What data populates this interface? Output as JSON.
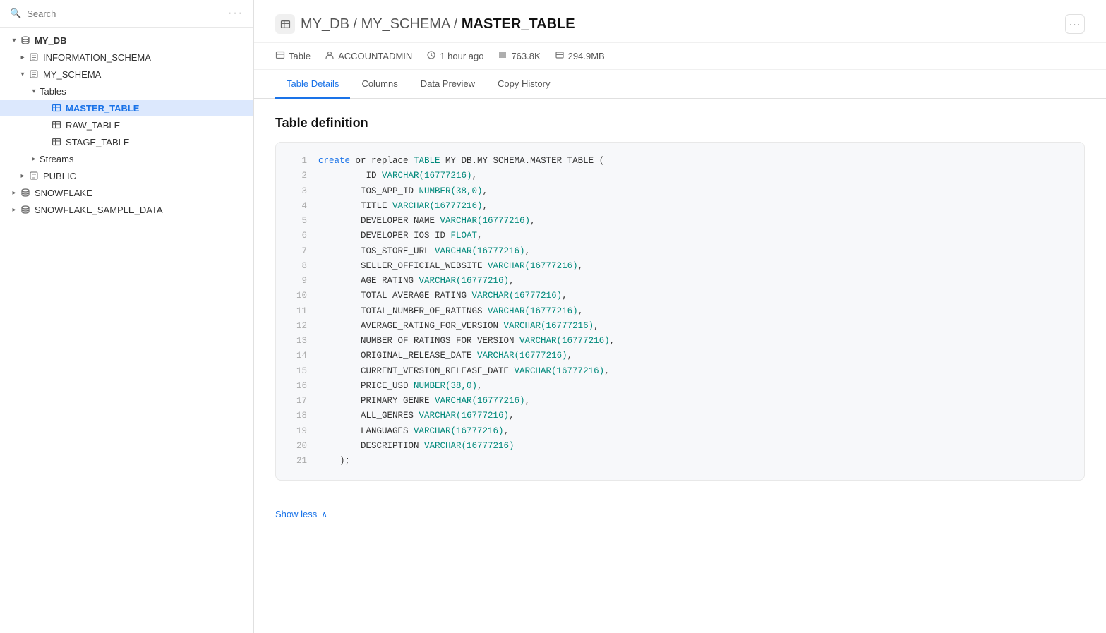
{
  "sidebar": {
    "search_placeholder": "Search",
    "databases": [
      {
        "name": "MY_DB",
        "expanded": true,
        "children": [
          {
            "name": "INFORMATION_SCHEMA",
            "type": "schema",
            "expanded": false
          },
          {
            "name": "MY_SCHEMA",
            "type": "schema",
            "expanded": true,
            "children": [
              {
                "name": "Tables",
                "type": "group",
                "expanded": true,
                "children": [
                  {
                    "name": "MASTER_TABLE",
                    "type": "table",
                    "selected": true
                  },
                  {
                    "name": "RAW_TABLE",
                    "type": "table",
                    "selected": false
                  },
                  {
                    "name": "STAGE_TABLE",
                    "type": "table",
                    "selected": false
                  }
                ]
              },
              {
                "name": "Streams",
                "type": "group",
                "expanded": false
              }
            ]
          },
          {
            "name": "PUBLIC",
            "type": "schema",
            "expanded": false
          }
        ]
      },
      {
        "name": "SNOWFLAKE",
        "expanded": false
      },
      {
        "name": "SNOWFLAKE_SAMPLE_DATA",
        "expanded": false
      }
    ]
  },
  "main": {
    "breadcrumb": {
      "db": "MY_DB",
      "schema": "MY_SCHEMA",
      "table": "MASTER_TABLE",
      "separator": " / "
    },
    "meta": {
      "type": "Table",
      "owner": "ACCOUNTADMIN",
      "modified": "1 hour ago",
      "rows": "763.8K",
      "size": "294.9MB"
    },
    "tabs": [
      {
        "label": "Table Details",
        "active": true
      },
      {
        "label": "Columns",
        "active": false
      },
      {
        "label": "Data Preview",
        "active": false
      },
      {
        "label": "Copy History",
        "active": false
      }
    ],
    "section_title": "Table definition",
    "show_less_label": "Show less",
    "code_lines": [
      {
        "num": 1,
        "code": "    create or replace TABLE MY_DB.MY_SCHEMA.MASTER_TABLE (",
        "parts": [
          {
            "t": "kw",
            "v": "create"
          },
          {
            "t": "plain",
            "v": " or replace "
          },
          {
            "t": "kw2",
            "v": "TABLE"
          },
          {
            "t": "plain",
            "v": " MY_DB.MY_SCHEMA.MASTER_TABLE ("
          }
        ]
      },
      {
        "num": 2,
        "code": "        _ID VARCHAR(16777216),",
        "parts": [
          {
            "t": "plain",
            "v": "        _ID "
          },
          {
            "t": "type",
            "v": "VARCHAR(16777216)"
          },
          {
            "t": "plain",
            "v": ","
          }
        ]
      },
      {
        "num": 3,
        "code": "        IOS_APP_ID NUMBER(38,0),",
        "parts": [
          {
            "t": "plain",
            "v": "        IOS_APP_ID "
          },
          {
            "t": "type",
            "v": "NUMBER(38,0)"
          },
          {
            "t": "plain",
            "v": ","
          }
        ]
      },
      {
        "num": 4,
        "code": "        TITLE VARCHAR(16777216),",
        "parts": [
          {
            "t": "plain",
            "v": "        TITLE "
          },
          {
            "t": "type",
            "v": "VARCHAR(16777216)"
          },
          {
            "t": "plain",
            "v": ","
          }
        ]
      },
      {
        "num": 5,
        "code": "        DEVELOPER_NAME VARCHAR(16777216),",
        "parts": [
          {
            "t": "plain",
            "v": "        DEVELOPER_NAME "
          },
          {
            "t": "type",
            "v": "VARCHAR(16777216)"
          },
          {
            "t": "plain",
            "v": ","
          }
        ]
      },
      {
        "num": 6,
        "code": "        DEVELOPER_IOS_ID FLOAT,",
        "parts": [
          {
            "t": "plain",
            "v": "        DEVELOPER_IOS_ID "
          },
          {
            "t": "type",
            "v": "FLOAT"
          },
          {
            "t": "plain",
            "v": ","
          }
        ]
      },
      {
        "num": 7,
        "code": "        IOS_STORE_URL VARCHAR(16777216),",
        "parts": [
          {
            "t": "plain",
            "v": "        IOS_STORE_URL "
          },
          {
            "t": "type",
            "v": "VARCHAR(16777216)"
          },
          {
            "t": "plain",
            "v": ","
          }
        ]
      },
      {
        "num": 8,
        "code": "        SELLER_OFFICIAL_WEBSITE VARCHAR(16777216),",
        "parts": [
          {
            "t": "plain",
            "v": "        SELLER_OFFICIAL_WEBSITE "
          },
          {
            "t": "type",
            "v": "VARCHAR(16777216)"
          },
          {
            "t": "plain",
            "v": ","
          }
        ]
      },
      {
        "num": 9,
        "code": "        AGE_RATING VARCHAR(16777216),",
        "parts": [
          {
            "t": "plain",
            "v": "        AGE_RATING "
          },
          {
            "t": "type",
            "v": "VARCHAR(16777216)"
          },
          {
            "t": "plain",
            "v": ","
          }
        ]
      },
      {
        "num": 10,
        "code": "        TOTAL_AVERAGE_RATING VARCHAR(16777216),",
        "parts": [
          {
            "t": "plain",
            "v": "        TOTAL_AVERAGE_RATING "
          },
          {
            "t": "type",
            "v": "VARCHAR(16777216)"
          },
          {
            "t": "plain",
            "v": ","
          }
        ]
      },
      {
        "num": 11,
        "code": "        TOTAL_NUMBER_OF_RATINGS VARCHAR(16777216),",
        "parts": [
          {
            "t": "plain",
            "v": "        TOTAL_NUMBER_OF_RATINGS "
          },
          {
            "t": "type",
            "v": "VARCHAR(16777216)"
          },
          {
            "t": "plain",
            "v": ","
          }
        ]
      },
      {
        "num": 12,
        "code": "        AVERAGE_RATING_FOR_VERSION VARCHAR(16777216),",
        "parts": [
          {
            "t": "plain",
            "v": "        AVERAGE_RATING_FOR_VERSION "
          },
          {
            "t": "type",
            "v": "VARCHAR(16777216)"
          },
          {
            "t": "plain",
            "v": ","
          }
        ]
      },
      {
        "num": 13,
        "code": "        NUMBER_OF_RATINGS_FOR_VERSION VARCHAR(16777216),",
        "parts": [
          {
            "t": "plain",
            "v": "        NUMBER_OF_RATINGS_FOR_VERSION "
          },
          {
            "t": "type",
            "v": "VARCHAR(16777216)"
          },
          {
            "t": "plain",
            "v": ","
          }
        ]
      },
      {
        "num": 14,
        "code": "        ORIGINAL_RELEASE_DATE VARCHAR(16777216),",
        "parts": [
          {
            "t": "plain",
            "v": "        ORIGINAL_RELEASE_DATE "
          },
          {
            "t": "type",
            "v": "VARCHAR(16777216)"
          },
          {
            "t": "plain",
            "v": ","
          }
        ]
      },
      {
        "num": 15,
        "code": "        CURRENT_VERSION_RELEASE_DATE VARCHAR(16777216),",
        "parts": [
          {
            "t": "plain",
            "v": "        CURRENT_VERSION_RELEASE_DATE "
          },
          {
            "t": "type",
            "v": "VARCHAR(16777216)"
          },
          {
            "t": "plain",
            "v": ","
          }
        ]
      },
      {
        "num": 16,
        "code": "        PRICE_USD NUMBER(38,0),",
        "parts": [
          {
            "t": "plain",
            "v": "        PRICE_USD "
          },
          {
            "t": "type",
            "v": "NUMBER(38,0)"
          },
          {
            "t": "plain",
            "v": ","
          }
        ]
      },
      {
        "num": 17,
        "code": "        PRIMARY_GENRE VARCHAR(16777216),",
        "parts": [
          {
            "t": "plain",
            "v": "        PRIMARY_GENRE "
          },
          {
            "t": "type",
            "v": "VARCHAR(16777216)"
          },
          {
            "t": "plain",
            "v": ","
          }
        ]
      },
      {
        "num": 18,
        "code": "        ALL_GENRES VARCHAR(16777216),",
        "parts": [
          {
            "t": "plain",
            "v": "        ALL_GENRES "
          },
          {
            "t": "type",
            "v": "VARCHAR(16777216)"
          },
          {
            "t": "plain",
            "v": ","
          }
        ]
      },
      {
        "num": 19,
        "code": "        LANGUAGES VARCHAR(16777216),",
        "parts": [
          {
            "t": "plain",
            "v": "        LANGUAGES "
          },
          {
            "t": "type",
            "v": "VARCHAR(16777216)"
          },
          {
            "t": "plain",
            "v": ","
          }
        ]
      },
      {
        "num": 20,
        "code": "        DESCRIPTION VARCHAR(16777216)",
        "parts": [
          {
            "t": "plain",
            "v": "        DESCRIPTION "
          },
          {
            "t": "type",
            "v": "VARCHAR(16777216)"
          }
        ]
      },
      {
        "num": 21,
        "code": "    );",
        "parts": [
          {
            "t": "plain",
            "v": "    );"
          }
        ]
      }
    ]
  }
}
